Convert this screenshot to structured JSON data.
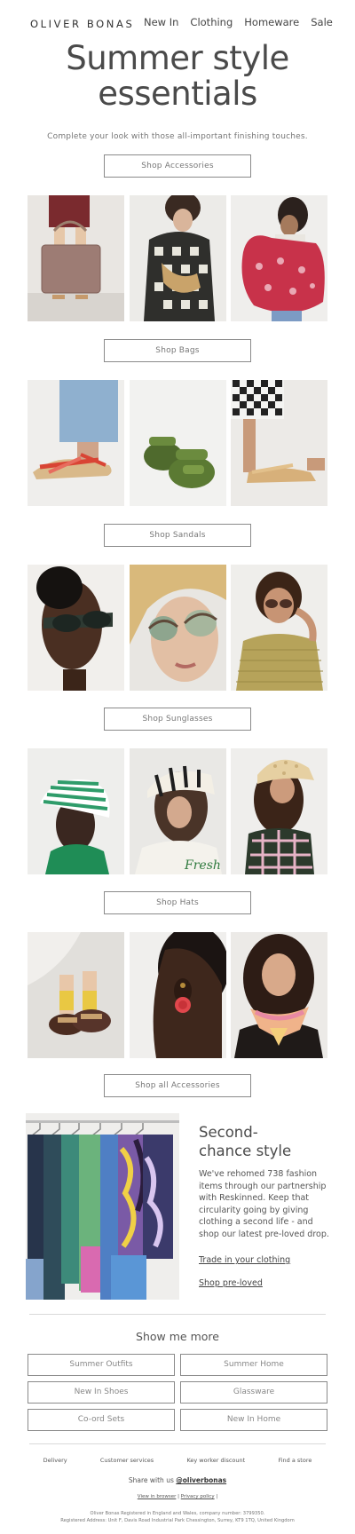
{
  "header": {
    "logo": "OLIVER BONAS",
    "nav": [
      "New In",
      "Clothing",
      "Homeware",
      "Sale"
    ]
  },
  "hero": {
    "title_line1": "Summer style",
    "title_line2": "essentials",
    "subtitle": "Complete your look with those all-important finishing touches."
  },
  "buttons": {
    "accessories": "Shop Accessories",
    "bags": "Shop Bags",
    "sandals": "Shop Sandals",
    "sunglasses": "Shop Sunglasses",
    "hats": "Shop Hats",
    "all_accessories": "Shop all Accessories"
  },
  "preloved": {
    "title_line1": "Second-",
    "title_line2": "chance style",
    "body": "We've rehomed 738 fashion items through our partnership with Reskinned. Keep that circularity going by giving clothing a second life - and shop our latest pre-loved drop.",
    "link_trade": "Trade in your clothing",
    "link_shop": "Shop pre-loved"
  },
  "more": {
    "title": "Show me more",
    "items": [
      "Summer Outfits",
      "Summer Home",
      "New In Shoes",
      "Glassware",
      "Co-ord Sets",
      "New In Home"
    ]
  },
  "footer": {
    "links": [
      "Delivery",
      "Customer services",
      "Key worker discount",
      "Find a store"
    ],
    "share_prefix": "Share with us ",
    "share_handle": "@oliverbonas",
    "view_browser": "View in browser",
    "sep": "|",
    "privacy": "Privacy policy",
    "legal1": "Oliver Bonas Registered in England and Wales, company number: 3799350.",
    "legal2": "Registered Address: Unit F, Davis Road Industrial Park Chessington, Surrey, KT9 1TQ, United Kingdom"
  }
}
